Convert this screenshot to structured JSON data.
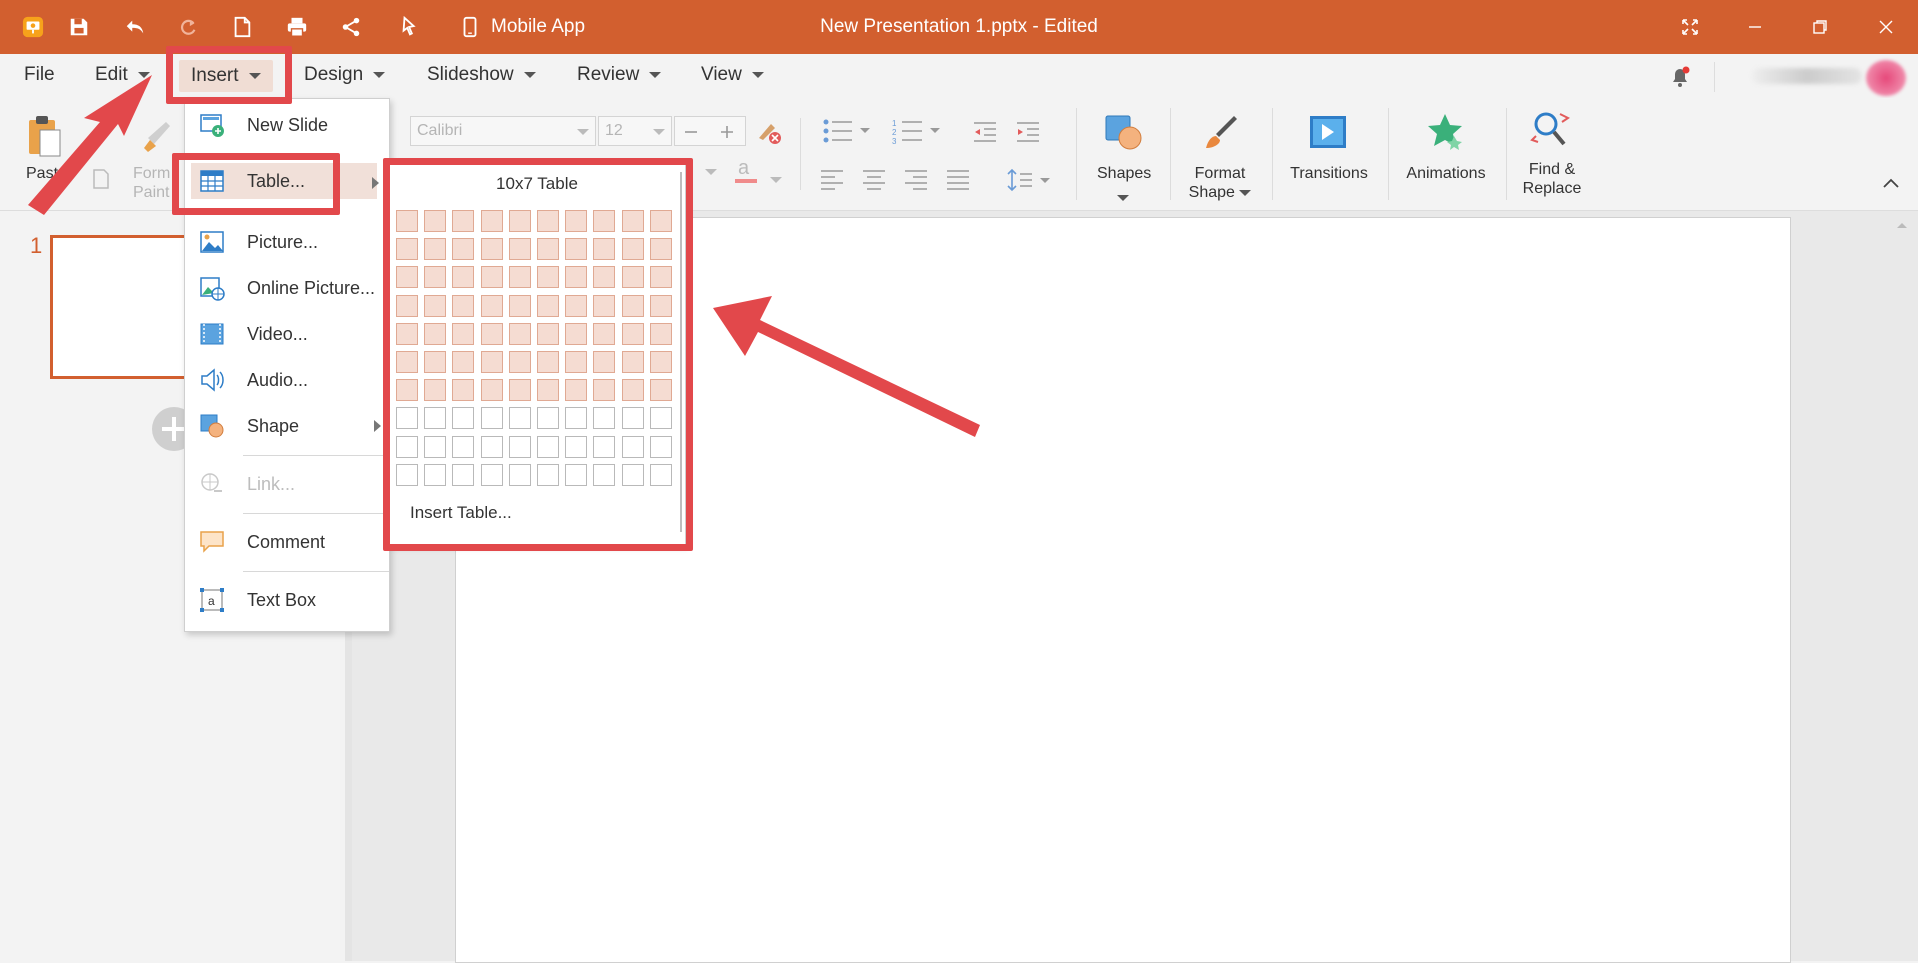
{
  "titlebar": {
    "mobile_app": "Mobile App",
    "document_title": "New Presentation 1.pptx - Edited",
    "accent": "#d25f2f"
  },
  "menubar": {
    "items": [
      {
        "label": "File"
      },
      {
        "label": "Edit"
      },
      {
        "label": "Insert"
      },
      {
        "label": "Design"
      },
      {
        "label": "Slideshow"
      },
      {
        "label": "Review"
      },
      {
        "label": "View"
      }
    ]
  },
  "ribbon": {
    "paste": "Past",
    "format_painter_1": "Form",
    "format_painter_2": "Paint",
    "font_name": "Calibri",
    "font_size": "12",
    "shapes": "Shapes",
    "format_shape_1": "Format",
    "format_shape_2": "Shape",
    "transitions": "Transitions",
    "animations": "Animations",
    "find_replace_1": "Find &",
    "find_replace_2": "Replace"
  },
  "slides_panel": {
    "slide_number": "1"
  },
  "insert_menu": {
    "items": [
      {
        "label": "New Slide",
        "icon": "new-slide-icon"
      },
      {
        "label": "Table...",
        "icon": "table-icon"
      },
      {
        "label": "Picture...",
        "icon": "picture-icon"
      },
      {
        "label": "Online Picture...",
        "icon": "online-picture-icon"
      },
      {
        "label": "Video...",
        "icon": "video-icon"
      },
      {
        "label": "Audio...",
        "icon": "audio-icon"
      },
      {
        "label": "Shape",
        "icon": "shape-icon"
      },
      {
        "label": "Link...",
        "icon": "link-icon"
      },
      {
        "label": "Comment",
        "icon": "comment-icon"
      },
      {
        "label": "Text Box",
        "icon": "text-box-icon"
      }
    ]
  },
  "table_picker": {
    "caption": "10x7 Table",
    "columns": 10,
    "rows": 10,
    "selected_columns": 10,
    "selected_rows": 7,
    "insert_table": "Insert Table..."
  },
  "annotation_color": "#e2484b"
}
